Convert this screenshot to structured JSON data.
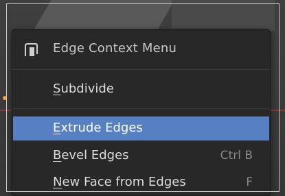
{
  "menu": {
    "title": "Edge Context Menu",
    "icon": "edge-menu-icon",
    "items": [
      {
        "label": "Subdivide",
        "shortcut": "",
        "active": false
      },
      {
        "label": "Extrude Edges",
        "shortcut": "",
        "active": true
      },
      {
        "label": "Bevel Edges",
        "shortcut": "Ctrl B",
        "active": false
      },
      {
        "label": "New Face from Edges",
        "shortcut": "F",
        "active": false
      }
    ]
  },
  "colors": {
    "menu_bg": "#282828",
    "highlight": "#5680c2",
    "text": "#dcdcdc",
    "shortcut": "#8a8a8a"
  }
}
